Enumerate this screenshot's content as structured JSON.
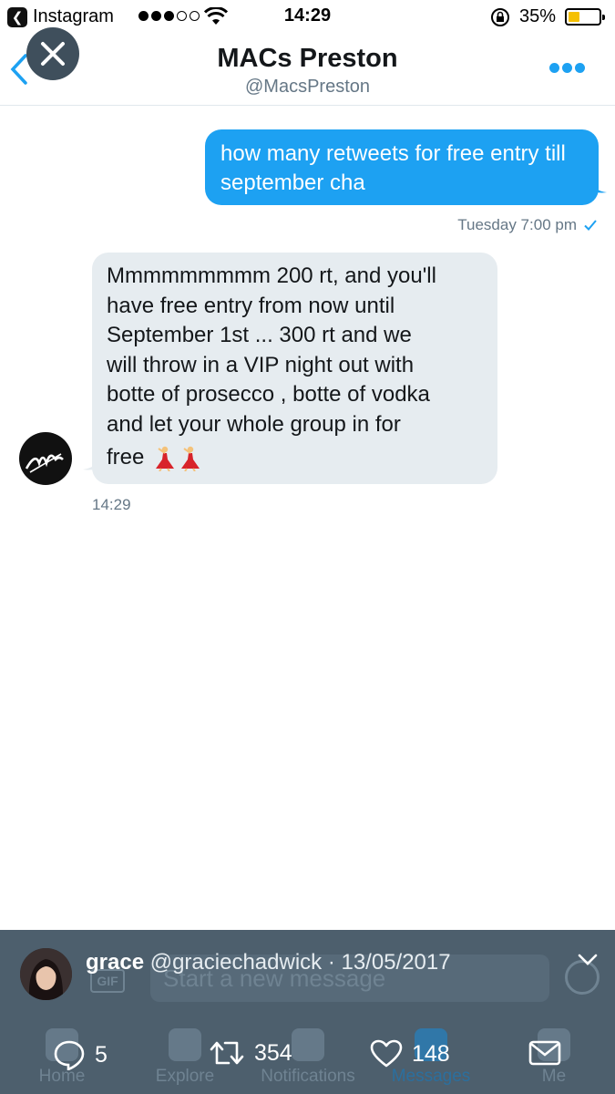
{
  "status_bar": {
    "back_app_label": "Instagram",
    "time": "14:29",
    "battery_pct": "35%",
    "battery_color": "#f5c000"
  },
  "header": {
    "title": "MACs Preston",
    "handle": "@MacsPreston",
    "accent": "#1da1f2"
  },
  "messages": {
    "sent": {
      "text": "how many retweets for free entry till september cha",
      "meta": "Tuesday 7:00 pm"
    },
    "received": {
      "lines": [
        "Mmmmmmmmm 200 rt, and you'll",
        "have free entry from now until",
        "September 1st ... 300 rt and we",
        "will throw in a VIP night out with",
        "botte of prosecco , botte of vodka",
        "and let your whole group in for"
      ],
      "last_word": "free",
      "time": "14:29"
    }
  },
  "composer": {
    "gif_label": "GIF",
    "placeholder": "Start a new message"
  },
  "tabbar": {
    "tabs": [
      "Home",
      "Explore",
      "Notifications",
      "Messages",
      "Me"
    ]
  },
  "tweet_overlay": {
    "name": "grace",
    "handle": "@graciechadwick",
    "date": "13/05/2017",
    "replies": "5",
    "retweets": "354",
    "likes": "148"
  }
}
